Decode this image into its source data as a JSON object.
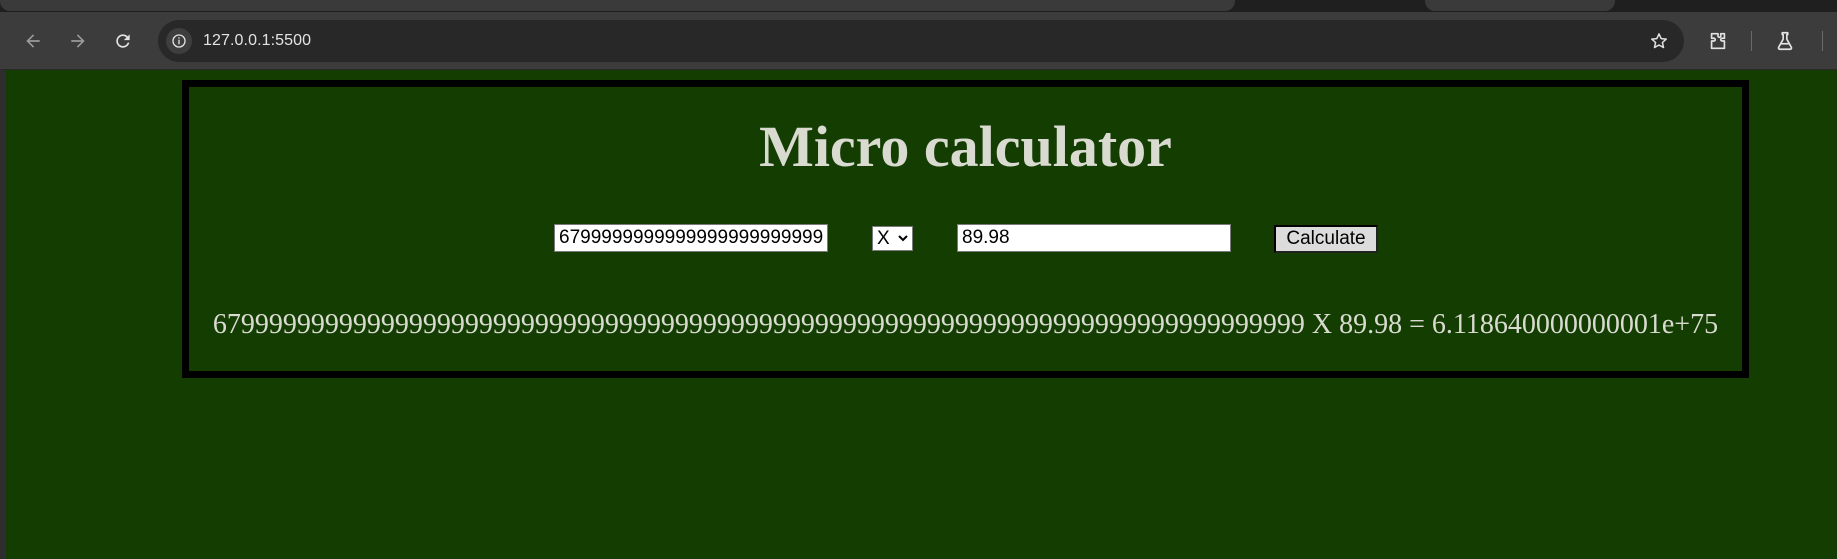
{
  "browser": {
    "url": "127.0.0.1:5500",
    "icons": {
      "back": "arrow-left",
      "forward": "arrow-right",
      "reload": "reload",
      "site_info": "tune/info",
      "bookmark": "star",
      "extensions": "puzzle",
      "labs": "flask"
    }
  },
  "page": {
    "title": "Micro calculator",
    "first_number": "679999999999999999999999999999999999999999999999999999999999999999999999999999",
    "operator": "X",
    "second_number": "89.98",
    "calculate_label": "Calculate",
    "result_text": "679999999999999999999999999999999999999999999999999999999999999999999999999999 X 89.98 = 6.118640000000001e+75"
  },
  "colors": {
    "page_background": "#143d02",
    "text": "#d9dbd0",
    "border": "#000000"
  }
}
